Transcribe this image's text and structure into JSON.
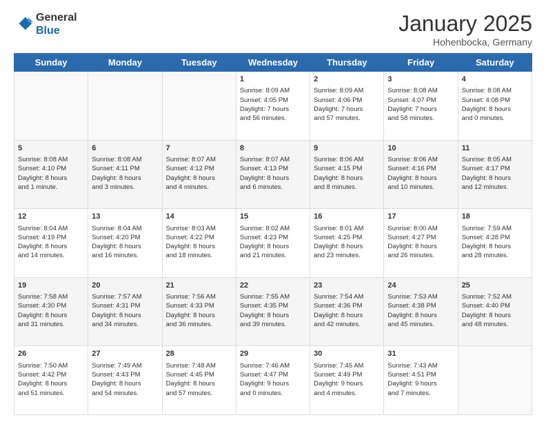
{
  "header": {
    "logo": {
      "line1": "General",
      "line2": "Blue"
    },
    "title": "January 2025",
    "subtitle": "Hohenbocka, Germany"
  },
  "weekdays": [
    "Sunday",
    "Monday",
    "Tuesday",
    "Wednesday",
    "Thursday",
    "Friday",
    "Saturday"
  ],
  "weeks": [
    [
      {
        "day": "",
        "info": ""
      },
      {
        "day": "",
        "info": ""
      },
      {
        "day": "",
        "info": ""
      },
      {
        "day": "1",
        "info": "Sunrise: 8:09 AM\nSunset: 4:05 PM\nDaylight: 7 hours\nand 56 minutes."
      },
      {
        "day": "2",
        "info": "Sunrise: 8:09 AM\nSunset: 4:06 PM\nDaylight: 7 hours\nand 57 minutes."
      },
      {
        "day": "3",
        "info": "Sunrise: 8:08 AM\nSunset: 4:07 PM\nDaylight: 7 hours\nand 58 minutes."
      },
      {
        "day": "4",
        "info": "Sunrise: 8:08 AM\nSunset: 4:08 PM\nDaylight: 8 hours\nand 0 minutes."
      }
    ],
    [
      {
        "day": "5",
        "info": "Sunrise: 8:08 AM\nSunset: 4:10 PM\nDaylight: 8 hours\nand 1 minute."
      },
      {
        "day": "6",
        "info": "Sunrise: 8:08 AM\nSunset: 4:11 PM\nDaylight: 8 hours\nand 3 minutes."
      },
      {
        "day": "7",
        "info": "Sunrise: 8:07 AM\nSunset: 4:12 PM\nDaylight: 8 hours\nand 4 minutes."
      },
      {
        "day": "8",
        "info": "Sunrise: 8:07 AM\nSunset: 4:13 PM\nDaylight: 8 hours\nand 6 minutes."
      },
      {
        "day": "9",
        "info": "Sunrise: 8:06 AM\nSunset: 4:15 PM\nDaylight: 8 hours\nand 8 minutes."
      },
      {
        "day": "10",
        "info": "Sunrise: 8:06 AM\nSunset: 4:16 PM\nDaylight: 8 hours\nand 10 minutes."
      },
      {
        "day": "11",
        "info": "Sunrise: 8:05 AM\nSunset: 4:17 PM\nDaylight: 8 hours\nand 12 minutes."
      }
    ],
    [
      {
        "day": "12",
        "info": "Sunrise: 8:04 AM\nSunset: 4:19 PM\nDaylight: 8 hours\nand 14 minutes."
      },
      {
        "day": "13",
        "info": "Sunrise: 8:04 AM\nSunset: 4:20 PM\nDaylight: 8 hours\nand 16 minutes."
      },
      {
        "day": "14",
        "info": "Sunrise: 8:03 AM\nSunset: 4:22 PM\nDaylight: 8 hours\nand 18 minutes."
      },
      {
        "day": "15",
        "info": "Sunrise: 8:02 AM\nSunset: 4:23 PM\nDaylight: 8 hours\nand 21 minutes."
      },
      {
        "day": "16",
        "info": "Sunrise: 8:01 AM\nSunset: 4:25 PM\nDaylight: 8 hours\nand 23 minutes."
      },
      {
        "day": "17",
        "info": "Sunrise: 8:00 AM\nSunset: 4:27 PM\nDaylight: 8 hours\nand 26 minutes."
      },
      {
        "day": "18",
        "info": "Sunrise: 7:59 AM\nSunset: 4:28 PM\nDaylight: 8 hours\nand 28 minutes."
      }
    ],
    [
      {
        "day": "19",
        "info": "Sunrise: 7:58 AM\nSunset: 4:30 PM\nDaylight: 8 hours\nand 31 minutes."
      },
      {
        "day": "20",
        "info": "Sunrise: 7:57 AM\nSunset: 4:31 PM\nDaylight: 8 hours\nand 34 minutes."
      },
      {
        "day": "21",
        "info": "Sunrise: 7:56 AM\nSunset: 4:33 PM\nDaylight: 8 hours\nand 36 minutes."
      },
      {
        "day": "22",
        "info": "Sunrise: 7:55 AM\nSunset: 4:35 PM\nDaylight: 8 hours\nand 39 minutes."
      },
      {
        "day": "23",
        "info": "Sunrise: 7:54 AM\nSunset: 4:36 PM\nDaylight: 8 hours\nand 42 minutes."
      },
      {
        "day": "24",
        "info": "Sunrise: 7:53 AM\nSunset: 4:38 PM\nDaylight: 8 hours\nand 45 minutes."
      },
      {
        "day": "25",
        "info": "Sunrise: 7:52 AM\nSunset: 4:40 PM\nDaylight: 8 hours\nand 48 minutes."
      }
    ],
    [
      {
        "day": "26",
        "info": "Sunrise: 7:50 AM\nSunset: 4:42 PM\nDaylight: 8 hours\nand 51 minutes."
      },
      {
        "day": "27",
        "info": "Sunrise: 7:49 AM\nSunset: 4:43 PM\nDaylight: 8 hours\nand 54 minutes."
      },
      {
        "day": "28",
        "info": "Sunrise: 7:48 AM\nSunset: 4:45 PM\nDaylight: 8 hours\nand 57 minutes."
      },
      {
        "day": "29",
        "info": "Sunrise: 7:46 AM\nSunset: 4:47 PM\nDaylight: 9 hours\nand 0 minutes."
      },
      {
        "day": "30",
        "info": "Sunrise: 7:45 AM\nSunset: 4:49 PM\nDaylight: 9 hours\nand 4 minutes."
      },
      {
        "day": "31",
        "info": "Sunrise: 7:43 AM\nSunset: 4:51 PM\nDaylight: 9 hours\nand 7 minutes."
      },
      {
        "day": "",
        "info": ""
      }
    ]
  ]
}
